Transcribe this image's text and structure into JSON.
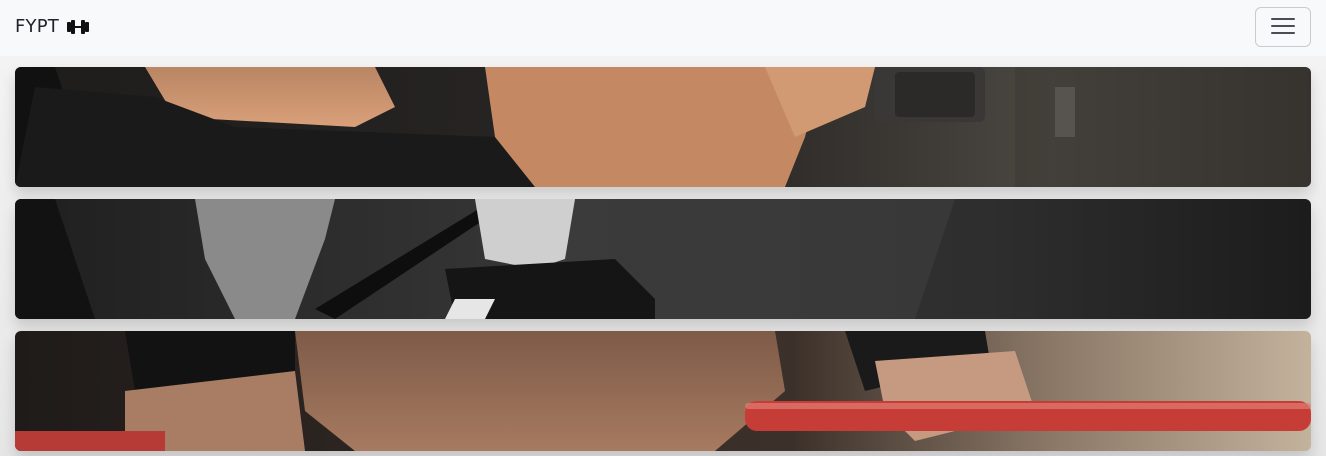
{
  "navbar": {
    "brand_text": "FYPT",
    "brand_icon": "dumbbell-icon",
    "menu_icon": "hamburger-menu-icon"
  },
  "cards": [
    {
      "image": "workout-dumbbell-photo"
    },
    {
      "image": "workout-barbell-photo"
    },
    {
      "image": "workout-pushup-photo"
    }
  ],
  "colors": {
    "navbar_bg": "#f8f9fa",
    "page_bg": "#e9e9ea"
  }
}
